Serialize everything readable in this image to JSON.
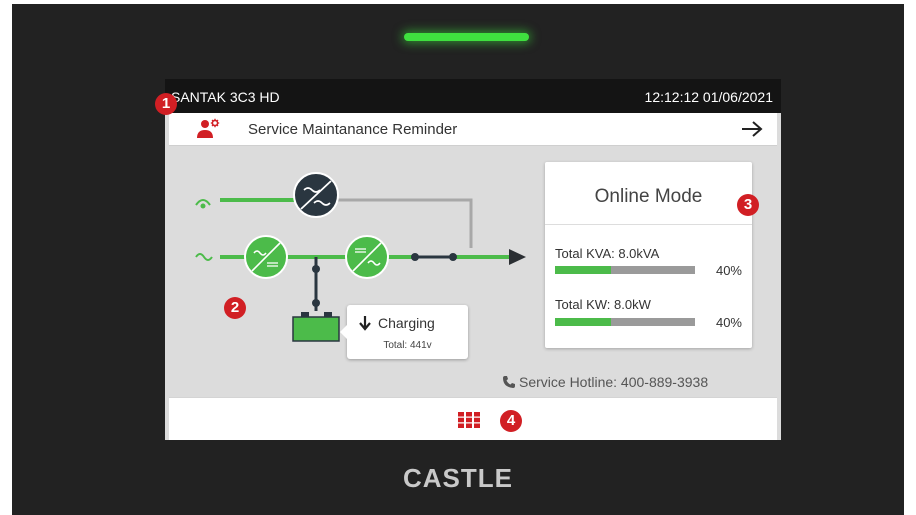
{
  "device": {
    "name": "SANTAK 3C3 HD",
    "datetime": "12:12:12 01/06/2021",
    "brand": "CASTLE"
  },
  "reminder": {
    "text": "Service Maintanance Reminder"
  },
  "mode_card": {
    "title": "Online Mode",
    "metrics": [
      {
        "label": "Total KVA: 8.0kVA",
        "percent_text": "40%",
        "percent": 40
      },
      {
        "label": "Total KW: 8.0kW",
        "percent_text": "40%",
        "percent": 40
      }
    ]
  },
  "battery": {
    "status": "Charging",
    "total": "Total:  441v"
  },
  "hotline": {
    "text": "Service Hotline: 400-889-3938"
  },
  "callouts": [
    "1",
    "2",
    "3",
    "4"
  ],
  "icons": {
    "reminder": "service-person-gear-icon",
    "arrow": "arrow-right-icon",
    "menu": "grid-menu-icon",
    "phone": "phone-icon",
    "charge": "arrow-down-icon"
  },
  "colors": {
    "accent_green": "#4cbb4a",
    "callout_red": "#d11f24",
    "status_bar": "#141414",
    "led": "#3fe03f"
  }
}
